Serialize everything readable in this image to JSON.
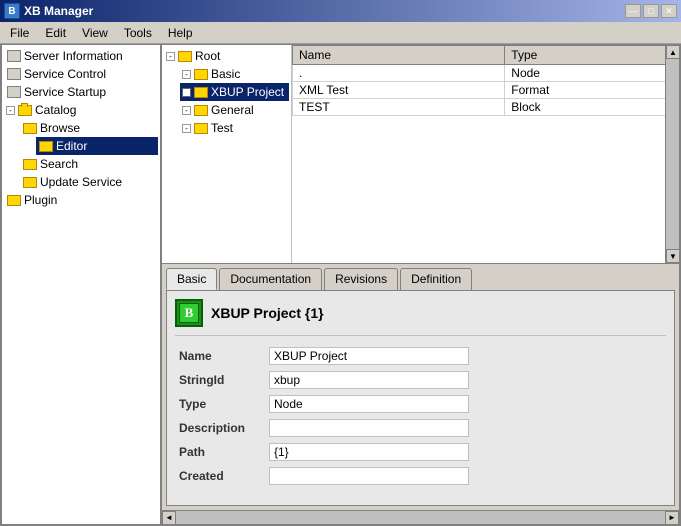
{
  "window": {
    "title": "XB Manager",
    "icon": "B"
  },
  "titleButtons": {
    "minimize": "—",
    "maximize": "□",
    "close": "✕"
  },
  "menu": {
    "items": [
      "File",
      "Edit",
      "View",
      "Tools",
      "Help"
    ]
  },
  "leftPanel": {
    "treeItems": [
      {
        "id": "server-info",
        "label": "Server Information",
        "level": 0,
        "hasExpand": false,
        "icon": "server"
      },
      {
        "id": "service-control",
        "label": "Service Control",
        "level": 0,
        "hasExpand": false,
        "icon": "server"
      },
      {
        "id": "service-startup",
        "label": "Service Startup",
        "level": 0,
        "hasExpand": false,
        "icon": "server"
      },
      {
        "id": "catalog",
        "label": "Catalog",
        "level": 0,
        "hasExpand": true,
        "expanded": true,
        "icon": "folder"
      },
      {
        "id": "browse",
        "label": "Browse",
        "level": 1,
        "hasExpand": false,
        "icon": "folder"
      },
      {
        "id": "editor",
        "label": "Editor",
        "level": 2,
        "hasExpand": false,
        "icon": "folder",
        "selected": true
      },
      {
        "id": "search",
        "label": "Search",
        "level": 1,
        "hasExpand": false,
        "icon": "folder"
      },
      {
        "id": "update-service",
        "label": "Update Service",
        "level": 1,
        "hasExpand": false,
        "icon": "folder"
      },
      {
        "id": "plugin",
        "label": "Plugin",
        "level": 0,
        "hasExpand": false,
        "icon": "folder"
      }
    ]
  },
  "topTable": {
    "columns": [
      "Name",
      "Type"
    ],
    "rows": [
      {
        "name": ".",
        "type": "Node",
        "selected": false
      },
      {
        "name": "XML Test",
        "type": "Format",
        "selected": false
      },
      {
        "name": "TEST",
        "type": "Block",
        "selected": false
      }
    ],
    "selectedRow": null
  },
  "middleTree": {
    "items": [
      {
        "id": "root",
        "label": "Root",
        "level": 0,
        "icon": "folder"
      },
      {
        "id": "basic",
        "label": "Basic",
        "level": 1,
        "icon": "folder"
      },
      {
        "id": "xbup",
        "label": "XBUP Project",
        "level": 1,
        "icon": "folder",
        "selected": true
      },
      {
        "id": "general",
        "label": "General",
        "level": 1,
        "icon": "folder"
      },
      {
        "id": "test",
        "label": "Test",
        "level": 1,
        "icon": "folder"
      }
    ]
  },
  "bottomPanel": {
    "tabs": [
      {
        "id": "basic",
        "label": "Basic",
        "active": true
      },
      {
        "id": "documentation",
        "label": "Documentation",
        "active": false
      },
      {
        "id": "revisions",
        "label": "Revisions",
        "active": false
      },
      {
        "id": "definition",
        "label": "Definition",
        "active": false
      }
    ],
    "basicTab": {
      "headerTitle": "XBUP Project {1}",
      "fields": [
        {
          "label": "Name",
          "value": "XBUP Project",
          "empty": false
        },
        {
          "label": "StringId",
          "value": "xbup",
          "empty": false
        },
        {
          "label": "Type",
          "value": "Node",
          "empty": false
        },
        {
          "label": "Description",
          "value": "",
          "empty": true
        },
        {
          "label": "Path",
          "value": "{1}",
          "empty": false
        },
        {
          "label": "Created",
          "value": "",
          "empty": true
        }
      ]
    }
  }
}
